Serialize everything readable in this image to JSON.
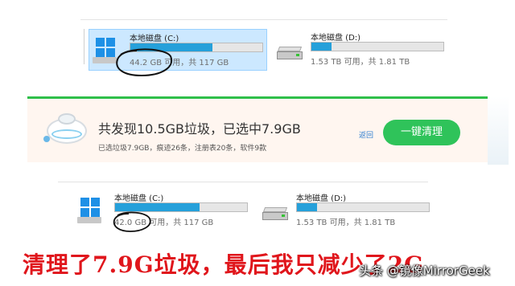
{
  "top_drives": [
    {
      "name": "本地磁盘 (C:)",
      "info": "44.2 GB 可用，共 117 GB",
      "used_fraction": 0.62
    },
    {
      "name": "本地磁盘 (D:)",
      "info": "1.53 TB 可用，共 1.81 TB",
      "used_fraction": 0.15
    }
  ],
  "bottom_drives": [
    {
      "name": "本地磁盘 (C:)",
      "info": "42.0 GB 可用，共 117 GB",
      "used_fraction": 0.64
    },
    {
      "name": "本地磁盘 (D:)",
      "info": "1.53 TB 可用，共 1.81 TB",
      "used_fraction": 0.15
    }
  ],
  "banner": {
    "title": "共发现10.5GB垃圾，已选中7.9GB",
    "detail": "已选垃圾7.9GB，痕迹26条，注册表20条，软件9款",
    "back_label": "返回",
    "clean_button": "一键清理"
  },
  "caption": "清理了7.9G垃圾，最后我只减少了2G",
  "watermark": "头条 @镜像MirrorGeek",
  "colors": {
    "accent_green": "#2fc35a",
    "bar_blue": "#26a0da",
    "caption_red": "#e0161c",
    "selection": "#cce8ff"
  }
}
